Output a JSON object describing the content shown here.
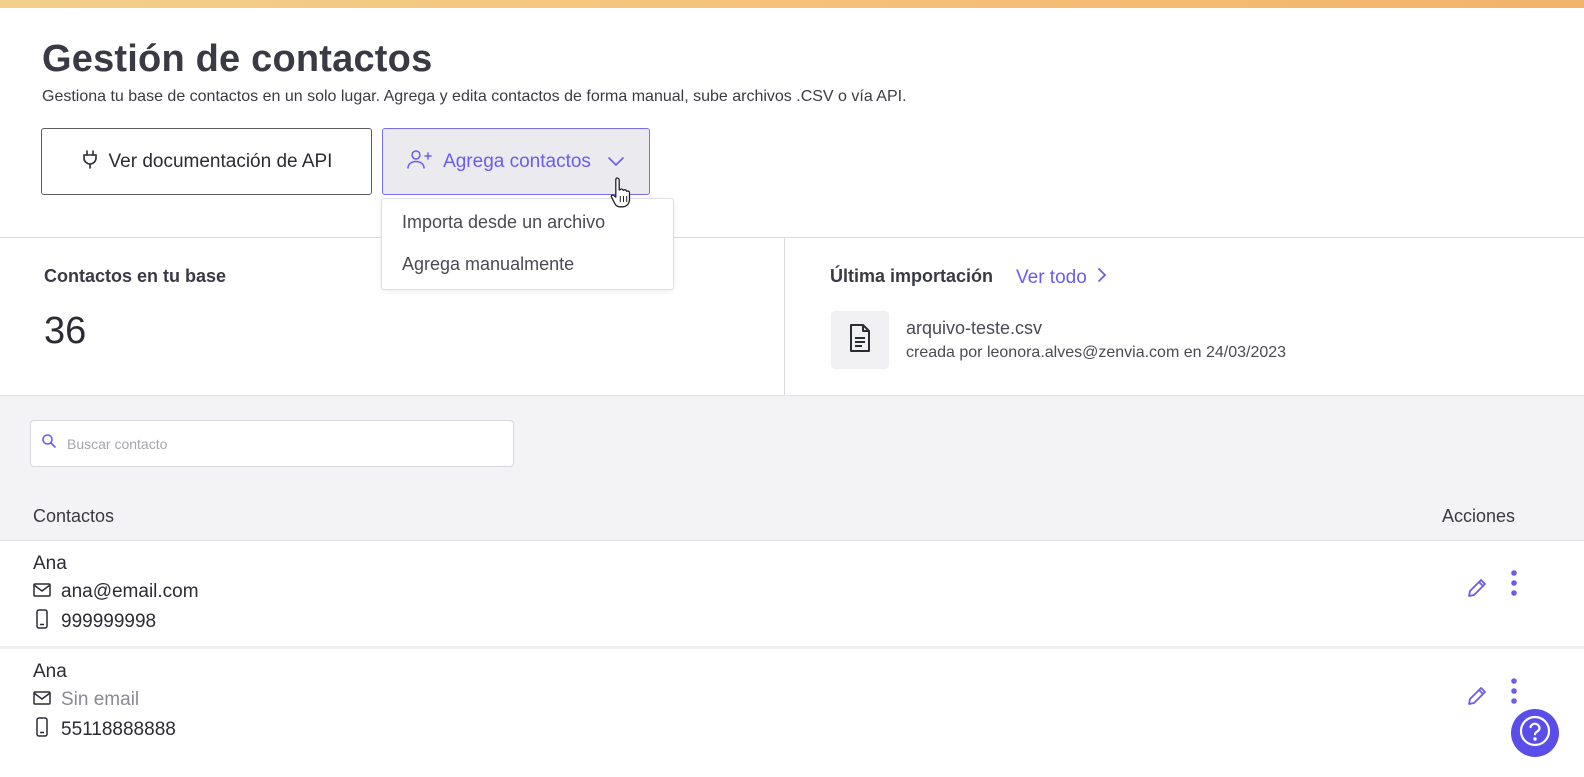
{
  "header": {
    "title": "Gestión de contactos",
    "subtitle": "Gestiona tu base de contactos en un solo lugar. Agrega y edita contactos de forma manual, sube archivos .CSV o vía API."
  },
  "actions": {
    "api_docs_label": "Ver documentación de API",
    "add_contacts_label": "Agrega contactos",
    "dropdown_items": [
      "Importa desde un archivo",
      "Agrega manualmente"
    ]
  },
  "stats": {
    "contacts_label": "Contactos en tu base",
    "contacts_count": "36"
  },
  "last_import": {
    "label": "Última importación",
    "view_all_label": "Ver todo",
    "file_name": "arquivo-teste.csv",
    "meta": "creada por leonora.alves@zenvia.com en 24/03/2023"
  },
  "search": {
    "placeholder": "Buscar contacto"
  },
  "table": {
    "col_contacts": "Contactos",
    "col_actions": "Acciones",
    "rows": [
      {
        "name": "Ana",
        "email": "ana@email.com",
        "phone": "999999998"
      },
      {
        "name": "Ana",
        "email": "Sin email",
        "phone": "55118888888"
      }
    ]
  },
  "colors": {
    "accent": "#6a5cf0",
    "help_button": "#5a4ee8",
    "top_bar": "#f5c27a"
  },
  "icons": {
    "api_button": "plug-icon",
    "add_button": "user-plus-icon",
    "add_chevron": "chevron-down-icon",
    "file": "file-text-icon",
    "search": "search-icon",
    "email": "mail-icon",
    "phone": "smartphone-icon",
    "edit": "pencil-icon",
    "more": "more-vertical-icon",
    "help": "help-circle-icon"
  }
}
